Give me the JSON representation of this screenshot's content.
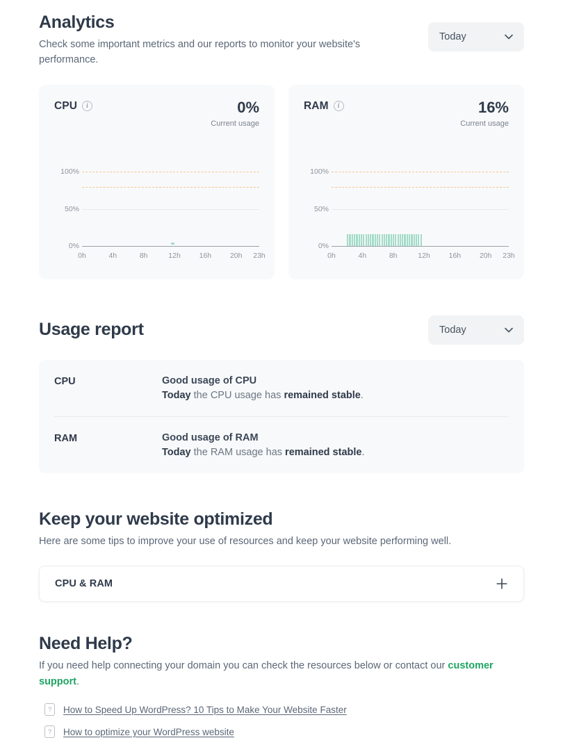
{
  "analytics": {
    "title": "Analytics",
    "subtitle": "Check some important metrics and our reports to monitor your website's performance.",
    "period_selector": {
      "value": "Today",
      "icon": "chevron-down-icon"
    },
    "cards": [
      {
        "title": "CPU",
        "info_icon": "info-circle-icon",
        "value": "0%",
        "caption": "Current usage"
      },
      {
        "title": "RAM",
        "info_icon": "info-circle-icon",
        "value": "16%",
        "caption": "Current usage"
      }
    ]
  },
  "usage_report": {
    "title": "Usage report",
    "period_selector": {
      "value": "Today",
      "icon": "chevron-down-icon"
    },
    "rows": [
      {
        "key": "CPU",
        "title": "Good usage of CPU",
        "desc_lead": "Today",
        "desc_mid": " the CPU usage has ",
        "desc_strong": "remained stable",
        "desc_tail": "."
      },
      {
        "key": "RAM",
        "title": "Good usage of RAM",
        "desc_lead": "Today",
        "desc_mid": " the RAM usage has ",
        "desc_strong": "remained stable",
        "desc_tail": "."
      }
    ]
  },
  "optimized": {
    "title": "Keep your website optimized",
    "subtitle": "Here are some tips to improve your use of resources and keep your website performing well.",
    "accordion": {
      "label": "CPU & RAM",
      "icon": "plus-icon"
    }
  },
  "need_help": {
    "title": "Need Help?",
    "text_lead": "If you need help connecting your domain you can check the resources below or contact our ",
    "link_text": "customer support",
    "text_tail": ".",
    "links": [
      {
        "icon": "question-doc-icon",
        "label": "How to Speed Up WordPress? 10 Tips to Make Your Website Faster"
      },
      {
        "icon": "question-doc-icon",
        "label": "How to optimize your WordPress website"
      }
    ]
  },
  "colors": {
    "heading": "#2f3a4a",
    "body": "#5b6777",
    "card_bg": "#f8f9fa",
    "accent_green": "#1fa463",
    "bar_green": "#a3dcc8",
    "warn_dashed": "#f2c893",
    "grid_light": "#e7e9ea",
    "axis": "#9aa3ab"
  },
  "chart_data": [
    {
      "type": "line",
      "title": "CPU",
      "xlabel": "",
      "ylabel": "",
      "x": [
        "0h",
        "4h",
        "8h",
        "12h",
        "16h",
        "20h",
        "23h"
      ],
      "x_ticks": [
        0,
        4,
        8,
        12,
        16,
        20,
        23
      ],
      "y_ticks": [
        0,
        50,
        100
      ],
      "y_tick_labels": [
        "0%",
        "50%",
        "100%"
      ],
      "ylim": [
        0,
        135
      ],
      "xlim": [
        0,
        23
      ],
      "grid": true,
      "threshold_lines": [
        {
          "value": 100,
          "style": "dashed",
          "color": "#f2c893"
        },
        {
          "value": 80,
          "style": "dashed",
          "color": "#f2c893"
        },
        {
          "value": 50,
          "style": "solid",
          "color": "#e7e9ea"
        },
        {
          "value": 0,
          "style": "solid",
          "color": "#9aa3ab"
        }
      ],
      "series": [
        {
          "name": "CPU usage",
          "color": "#a3dcc8",
          "values_x": [
            11.7
          ],
          "values_y": [
            2
          ]
        }
      ],
      "current_value": 0,
      "current_label": "0%",
      "legend": "none"
    },
    {
      "type": "bar",
      "title": "RAM",
      "xlabel": "",
      "ylabel": "",
      "x": [
        "0h",
        "4h",
        "8h",
        "12h",
        "16h",
        "20h",
        "23h"
      ],
      "x_ticks": [
        0,
        4,
        8,
        12,
        16,
        20,
        23
      ],
      "y_ticks": [
        0,
        50,
        100
      ],
      "y_tick_labels": [
        "0%",
        "50%",
        "100%"
      ],
      "ylim": [
        0,
        135
      ],
      "xlim": [
        0,
        23
      ],
      "grid": true,
      "threshold_lines": [
        {
          "value": 100,
          "style": "dashed",
          "color": "#f2c893"
        },
        {
          "value": 80,
          "style": "dashed",
          "color": "#f2c893"
        },
        {
          "value": 50,
          "style": "solid",
          "color": "#e7e9ea"
        },
        {
          "value": 0,
          "style": "solid",
          "color": "#9aa3ab"
        }
      ],
      "bar_color": "#a3dcc8",
      "bar_start_hour": 2.0,
      "bar_end_hour": 11.8,
      "bar_count": 33,
      "values": [
        16,
        16,
        16,
        16,
        16,
        16,
        16,
        16,
        16,
        16,
        16,
        16,
        16,
        16,
        16,
        16,
        16,
        16,
        16,
        16,
        16,
        16,
        16,
        16,
        16,
        16,
        16,
        16,
        16,
        16,
        16,
        16,
        16
      ],
      "current_value": 16,
      "current_label": "16%",
      "legend": "none"
    }
  ]
}
